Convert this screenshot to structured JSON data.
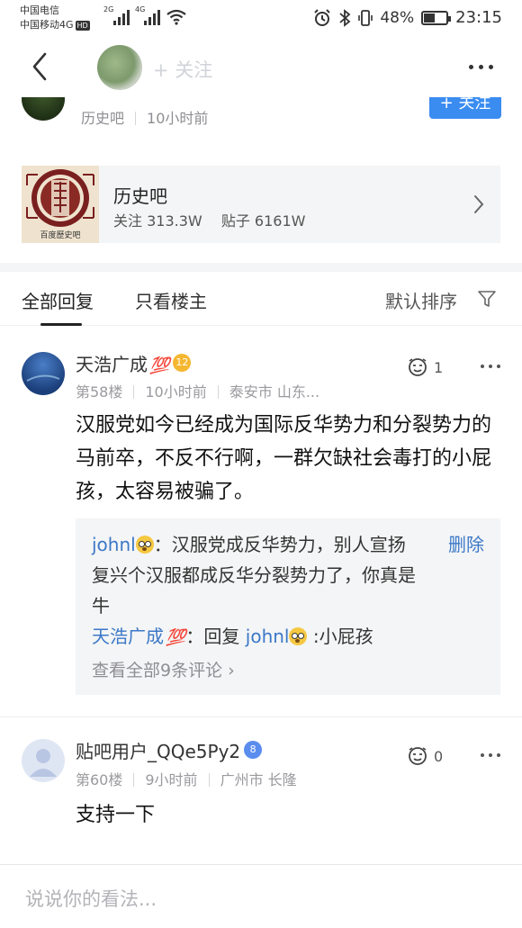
{
  "status_bar": {
    "carrier1": "中国电信",
    "carrier2": "中国移动4G",
    "hd": "HD",
    "net1": "2G",
    "net2": "4G",
    "battery_percent": "48%",
    "battery_level": 0.48,
    "time": "23:15"
  },
  "nav": {
    "follow_label": "+ 关注"
  },
  "post": {
    "forum_name": "历史吧",
    "time_ago": "10小时前",
    "follow_button": "+ 关注"
  },
  "forum_card": {
    "name": "历史吧",
    "followers": "关注 313.3W",
    "posts": "贴子 6161W",
    "logo_caption": "百度歷史吧"
  },
  "tabs": {
    "all": "全部回复",
    "owner_only": "只看楼主",
    "sort": "默认排序"
  },
  "comments": [
    {
      "name": "天浩广成",
      "badge": "💯",
      "level": "12",
      "level_color": "#f5b731",
      "floor": "第58楼",
      "time": "10小时前",
      "location": "泰安市 山东...",
      "likes": "1",
      "content": "汉服党如今已经成为国际反华势力和分裂势力的马前卒，不反不行啊，一群欠缺社会毒打的小屁孩，太容易被骗了。",
      "replies": {
        "r1_name": "johnl",
        "r1_text": "：汉服党成反华势力，别人宣扬复兴个汉服都成反华分裂势力了，你真是牛",
        "r1_action": "删除",
        "r2_name": "天浩广成",
        "r2_badge": "💯",
        "r2_prefix": "：回复 ",
        "r2_target": "johnl",
        "r2_text": " :小屁孩",
        "more": "查看全部9条评论 ›"
      }
    },
    {
      "name": "贴吧用户_QQe5Py2",
      "level": "8",
      "level_color": "#5b8def",
      "floor": "第60楼",
      "time": "9小时前",
      "location": "广州市 长隆",
      "likes": "0",
      "content": "支持一下"
    }
  ],
  "bottom": {
    "placeholder": "说说你的看法..."
  }
}
